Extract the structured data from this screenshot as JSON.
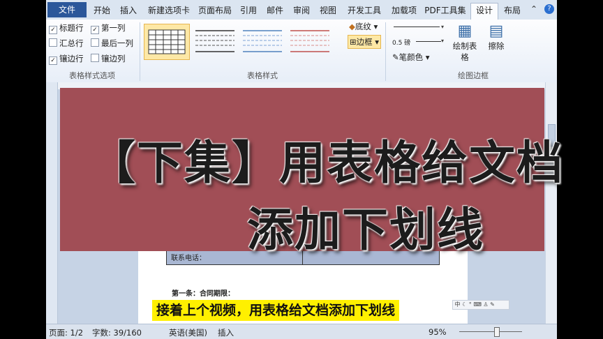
{
  "tabs": [
    "文件",
    "开始",
    "插入",
    "新建选项卡",
    "页面布局",
    "引用",
    "邮件",
    "审阅",
    "视图",
    "开发工具",
    "加载项",
    "PDF工具集",
    "设计",
    "布局"
  ],
  "style_options": {
    "items": [
      {
        "label": "标题行",
        "checked": true
      },
      {
        "label": "第一列",
        "checked": true
      },
      {
        "label": "汇总行",
        "checked": false
      },
      {
        "label": "最后一列",
        "checked": false
      },
      {
        "label": "镶边行",
        "checked": true
      },
      {
        "label": "镶边列",
        "checked": false
      }
    ],
    "group_label": "表格样式选项"
  },
  "table_styles": {
    "group_label": "表格样式",
    "shading": "底纹",
    "borders": "边框"
  },
  "draw_borders": {
    "pen_weight": "0.5 磅",
    "pen_color": "笔颜色",
    "draw_table": "绘制表格",
    "eraser": "擦除",
    "group_label": "绘图边框"
  },
  "document": {
    "cell_label": "联系电话：",
    "clause": "第一条：合同期限："
  },
  "status": {
    "page": "页面: 1/2",
    "words": "字数: 39/160",
    "language": "英语(美国)",
    "mode": "插入",
    "zoom": "95%"
  },
  "overlay": {
    "title_line1": "【下集】用表格给文档",
    "title_line2": "添加下划线",
    "subtitle": "接着上个视频，用表格给文档添加下划线"
  },
  "colors": {
    "banner": "#a14e56",
    "caption_bg": "#fff000",
    "file_tab": "#2b579a"
  },
  "icons": [
    "minimize-ribbon-icon",
    "help-icon",
    "shading-icon",
    "borders-icon",
    "draw-table-icon",
    "eraser-icon",
    "pen-color-icon"
  ]
}
